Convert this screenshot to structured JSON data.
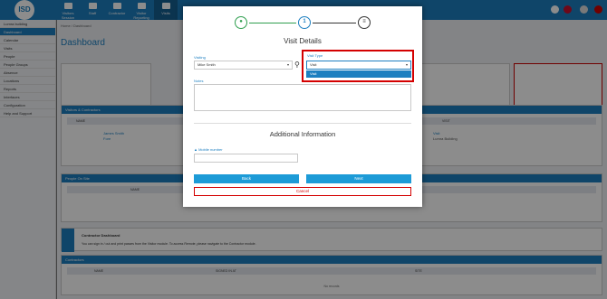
{
  "app": {
    "logo": "ISD"
  },
  "topnav": [
    {
      "label": "Visitors Session",
      "active": false
    },
    {
      "label": "Staff",
      "active": false
    },
    {
      "label": "Contractor",
      "active": false
    },
    {
      "label": "Visitor Reporting",
      "active": false
    },
    {
      "label": "Visits",
      "active": true
    }
  ],
  "sidebar": [
    "Lumra building",
    "Dashboard",
    "Calendar",
    "Visits",
    "People",
    "People Groups",
    "Absence",
    "Locations",
    "Reports",
    "Interfaces",
    "Configuration",
    "Help and Support"
  ],
  "main": {
    "breadcrumb": "Home / Dashboard",
    "title": "Dashboard",
    "cards": [
      {
        "label": "Record Visit Visitor"
      },
      {
        "label": "Remark"
      },
      {
        "label": "Evacuation Register"
      }
    ],
    "panel_visitors": {
      "title": "Visitors & Contractors",
      "col_name": "NAME",
      "col_visit": "VISIT",
      "row_name": "James Smith",
      "row_sub": "Fore",
      "row_visit": "Visit",
      "row_visit_sub": "Lumra Building"
    },
    "panel_people": {
      "title": "People On Site",
      "col_name": "NAME"
    },
    "panel_contractor": {
      "title": "Contractor Dashboard",
      "text": "You can sign in / out and print passes from the Visitor module. To access Remote, please navigate to the Contractor module."
    },
    "panel_contractors": {
      "title": "Contractors",
      "col_name": "NAME",
      "col_signed": "SIGNED IN AT",
      "col_site": "SITE",
      "empty": "No records"
    }
  },
  "modal": {
    "steps": [
      "1",
      "2"
    ],
    "title": "Visit Details",
    "visiting_label": "Visiting",
    "visiting_value": "Mike Smith",
    "visit_type_label": "Visit Type",
    "visit_type_value": "Visit",
    "visit_type_options": [
      "Visit"
    ],
    "notes_label": "Notes",
    "section2_title": "Additional Information",
    "mobile_label": "Mobile number",
    "back_label": "Back",
    "next_label": "Next",
    "cancel_label": "Cancel"
  },
  "colors": {
    "primary": "#1d7fc0",
    "success": "#2e9e4e",
    "danger": "#d40000"
  }
}
